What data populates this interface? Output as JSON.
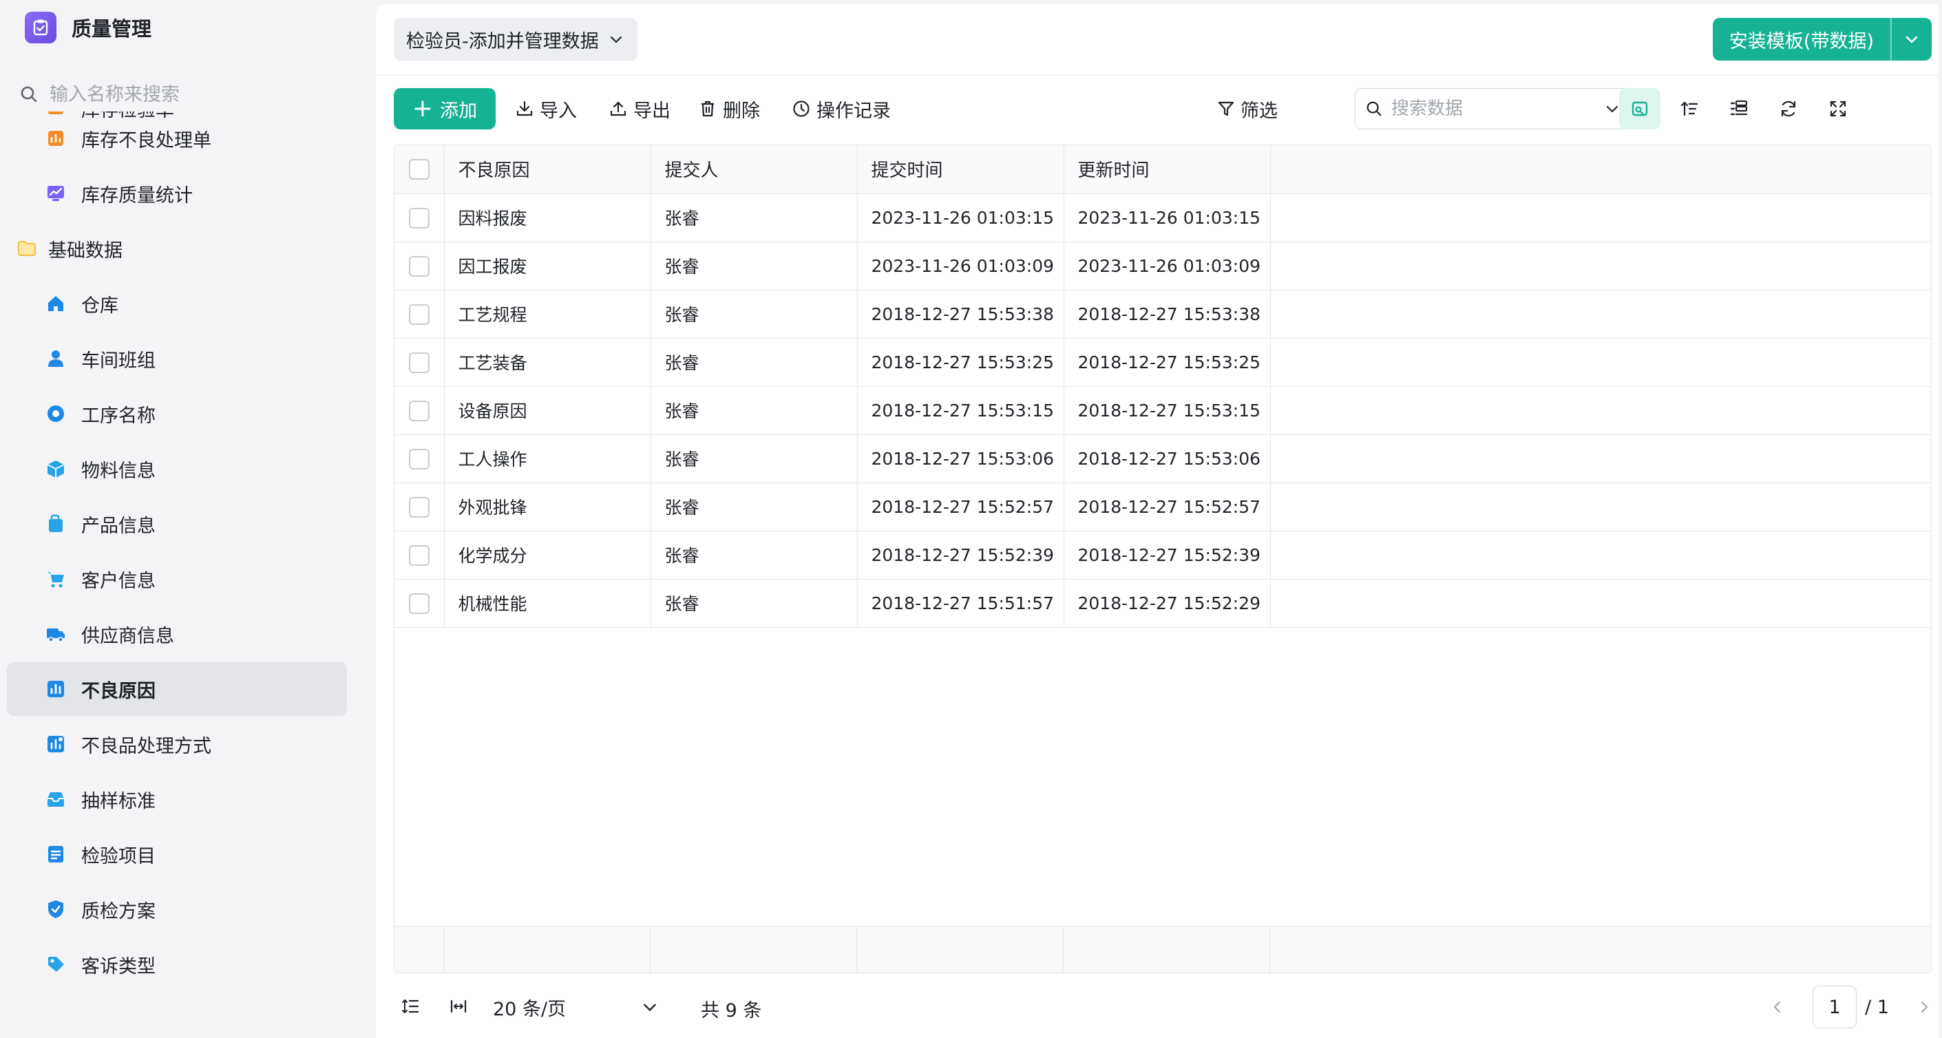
{
  "app": {
    "title": "质量管理"
  },
  "sidebar": {
    "search_placeholder": "输入名称来搜索",
    "items": [
      {
        "label": "库存检验单",
        "icon": "stock-inspection-icon",
        "color": "#f28c28",
        "level": "child"
      },
      {
        "label": "库存不良处理单",
        "icon": "stock-defect-handling-icon",
        "color": "#f28c28",
        "level": "child"
      },
      {
        "label": "库存质量统计",
        "icon": "trend-chart-icon",
        "color": "#7b61ff",
        "level": "child"
      },
      {
        "label": "基础数据",
        "icon": "folder-icon",
        "color": "#f5c044",
        "level": "group"
      },
      {
        "label": "仓库",
        "icon": "home-icon",
        "color": "#1e88e5",
        "level": "child"
      },
      {
        "label": "车间班组",
        "icon": "user-icon",
        "color": "#1e88e5",
        "level": "child"
      },
      {
        "label": "工序名称",
        "icon": "circle-icon",
        "color": "#1e88e5",
        "level": "child"
      },
      {
        "label": "物料信息",
        "icon": "cube-icon",
        "color": "#29a3e8",
        "level": "child"
      },
      {
        "label": "产品信息",
        "icon": "product-icon",
        "color": "#29a3e8",
        "level": "child"
      },
      {
        "label": "客户信息",
        "icon": "cart-icon",
        "color": "#29a3e8",
        "level": "child"
      },
      {
        "label": "供应商信息",
        "icon": "truck-icon",
        "color": "#1e88e5",
        "level": "child"
      },
      {
        "label": "不良原因",
        "icon": "bar-chart-icon",
        "color": "#1e88e5",
        "level": "child",
        "active": true
      },
      {
        "label": "不良品处理方式",
        "icon": "defect-method-icon",
        "color": "#1e88e5",
        "level": "child"
      },
      {
        "label": "抽样标准",
        "icon": "inbox-icon",
        "color": "#29a3e8",
        "level": "child"
      },
      {
        "label": "检验项目",
        "icon": "document-icon",
        "color": "#1e88e5",
        "level": "child"
      },
      {
        "label": "质检方案",
        "icon": "shield-icon",
        "color": "#1e88e5",
        "level": "child"
      },
      {
        "label": "客诉类型",
        "icon": "tag-icon",
        "color": "#29a3e8",
        "level": "child"
      }
    ]
  },
  "header": {
    "page_selector": "检验员-添加并管理数据",
    "install_button": "安装模板(带数据)"
  },
  "toolbar": {
    "add": "添加",
    "import": "导入",
    "export": "导出",
    "delete": "删除",
    "history": "操作记录",
    "search_placeholder": "搜索数据",
    "filter": "筛选"
  },
  "table": {
    "columns": [
      "不良原因",
      "提交人",
      "提交时间",
      "更新时间"
    ],
    "rows": [
      [
        "因料报废",
        "张睿",
        "2023-11-26 01:03:15",
        "2023-11-26 01:03:15"
      ],
      [
        "因工报废",
        "张睿",
        "2023-11-26 01:03:09",
        "2023-11-26 01:03:09"
      ],
      [
        "工艺规程",
        "张睿",
        "2018-12-27 15:53:38",
        "2018-12-27 15:53:38"
      ],
      [
        "工艺装备",
        "张睿",
        "2018-12-27 15:53:25",
        "2018-12-27 15:53:25"
      ],
      [
        "设备原因",
        "张睿",
        "2018-12-27 15:53:15",
        "2018-12-27 15:53:15"
      ],
      [
        "工人操作",
        "张睿",
        "2018-12-27 15:53:06",
        "2018-12-27 15:53:06"
      ],
      [
        "外观批锋",
        "张睿",
        "2018-12-27 15:52:57",
        "2018-12-27 15:52:57"
      ],
      [
        "化学成分",
        "张睿",
        "2018-12-27 15:52:39",
        "2018-12-27 15:52:39"
      ],
      [
        "机械性能",
        "张睿",
        "2018-12-27 15:51:57",
        "2018-12-27 15:52:29"
      ]
    ]
  },
  "pagination": {
    "page_size": "20 条/页",
    "total": "共 9 条",
    "current_page": "1",
    "total_pages": "/ 1"
  },
  "colors": {
    "accent": "#16b294",
    "brand": "#7b5cf0",
    "active_menu_bg": "#e4e5e9"
  }
}
